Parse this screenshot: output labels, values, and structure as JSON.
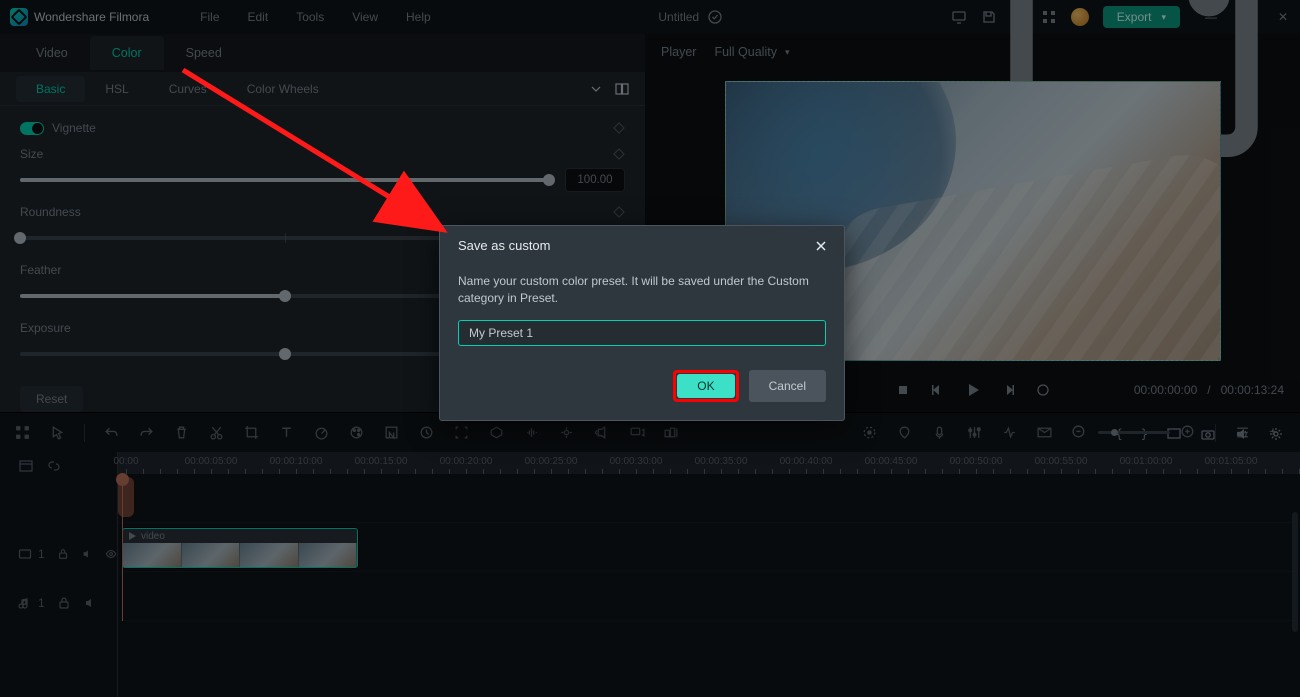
{
  "app": {
    "title": "Wondershare Filmora",
    "doc_title": "Untitled"
  },
  "menu": {
    "file": "File",
    "edit": "Edit",
    "tools": "Tools",
    "view": "View",
    "help": "Help"
  },
  "export_label": "Export",
  "editor_tabs": {
    "video": "Video",
    "color": "Color",
    "speed": "Speed"
  },
  "color_tabs": {
    "basic": "Basic",
    "hsl": "HSL",
    "curves": "Curves",
    "wheels": "Color Wheels"
  },
  "color_panel": {
    "vignette_label": "Vignette",
    "size": {
      "label": "Size",
      "value": "100.00",
      "pct": 100
    },
    "roundness": {
      "label": "Roundness",
      "pct": 0
    },
    "feather": {
      "label": "Feather",
      "pct": 50
    },
    "exposure": {
      "label": "Exposure",
      "pct": 50
    },
    "reset_label": "Reset"
  },
  "player": {
    "label": "Player",
    "quality_label": "Full Quality",
    "time_current": "00:00:00:00",
    "time_total": "00:00:13:24"
  },
  "dialog": {
    "title": "Save as custom",
    "message": "Name your custom color preset. It will be saved under the Custom category in Preset.",
    "input_value": "My Preset 1",
    "ok": "OK",
    "cancel": "Cancel"
  },
  "timeline": {
    "ruler": [
      "00:00",
      "00:00:05:00",
      "00:00:10:00",
      "00:00:15:00",
      "00:00:20:00",
      "00:00:25:00",
      "00:00:30:00",
      "00:00:35:00",
      "00:00:40:00",
      "00:00:45:00",
      "00:00:50:00",
      "00:00:55:00",
      "00:01:00:00",
      "00:01:05:00"
    ],
    "overlay_track_index": "1",
    "video_track_index": "1",
    "audio_track_index": "1",
    "clip_name": "video"
  }
}
